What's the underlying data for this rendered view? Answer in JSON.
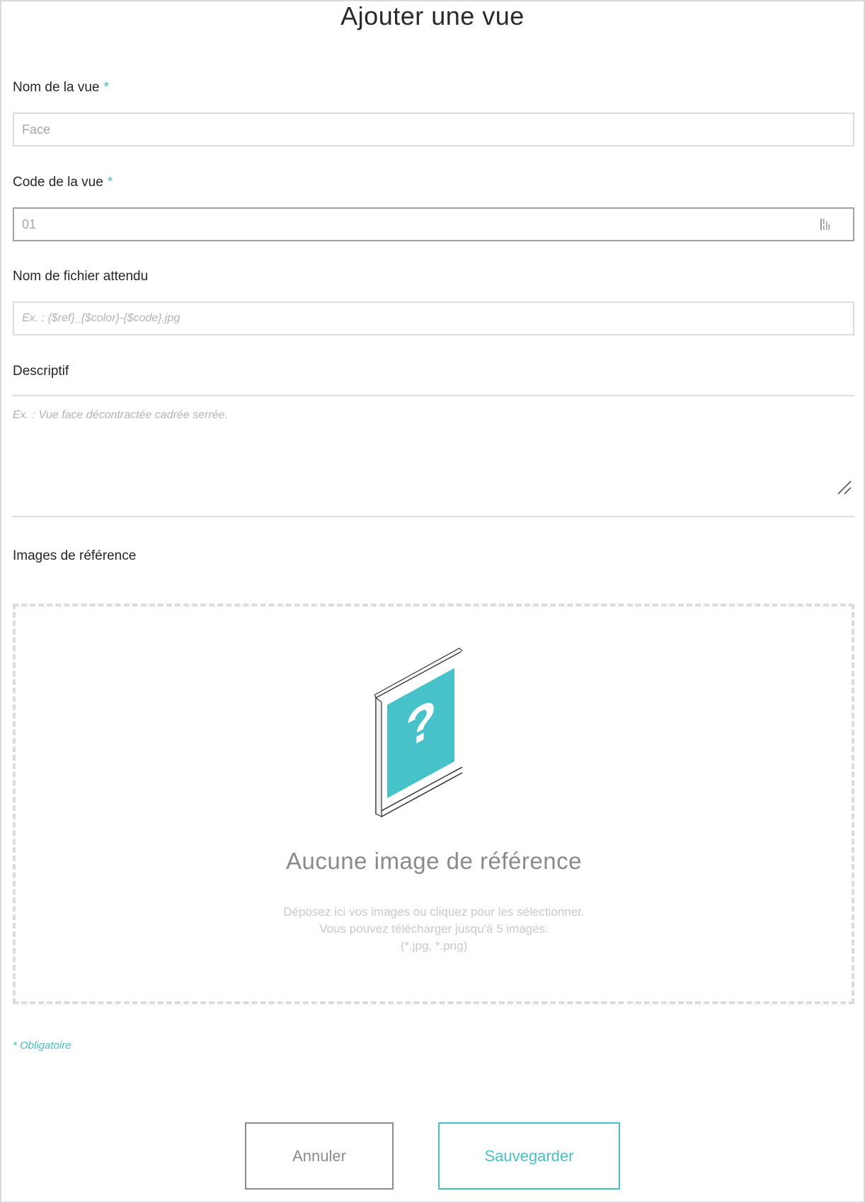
{
  "dialog": {
    "title": "Ajouter une vue"
  },
  "form": {
    "view_name": {
      "label": "Nom de la vue",
      "required_mark": "*",
      "placeholder": "Face"
    },
    "view_code": {
      "label": "Code de la vue",
      "required_mark": "*",
      "placeholder": "01",
      "icon": "barcode-icon"
    },
    "expected_filename": {
      "label": "Nom de fichier attendu",
      "placeholder": "Ex. : {$ref}_{$color}-{$code}.jpg"
    },
    "description": {
      "label": "Descriptif",
      "placeholder": "Ex. : Vue face décontractée cadrée serrée.",
      "icon": "resize-handle-icon"
    },
    "reference_images": {
      "label": "Images de référence",
      "empty_title": "Aucune image de référence",
      "hint_line1": "Déposez ici vos images ou cliquez pour les sélectionner.",
      "hint_line2": "Vous pouvez télécharger jusqu'à 5 images.",
      "hint_line3": "(*.jpg, *.png)",
      "icon": "unknown-image-icon"
    },
    "mandatory_note": "* Obligatoire"
  },
  "actions": {
    "cancel_label": "Annuler",
    "save_label": "Sauvegarder"
  },
  "colors": {
    "accent": "#46bfc6",
    "border": "#dcdcdc",
    "cancel_border": "#888e8e"
  }
}
